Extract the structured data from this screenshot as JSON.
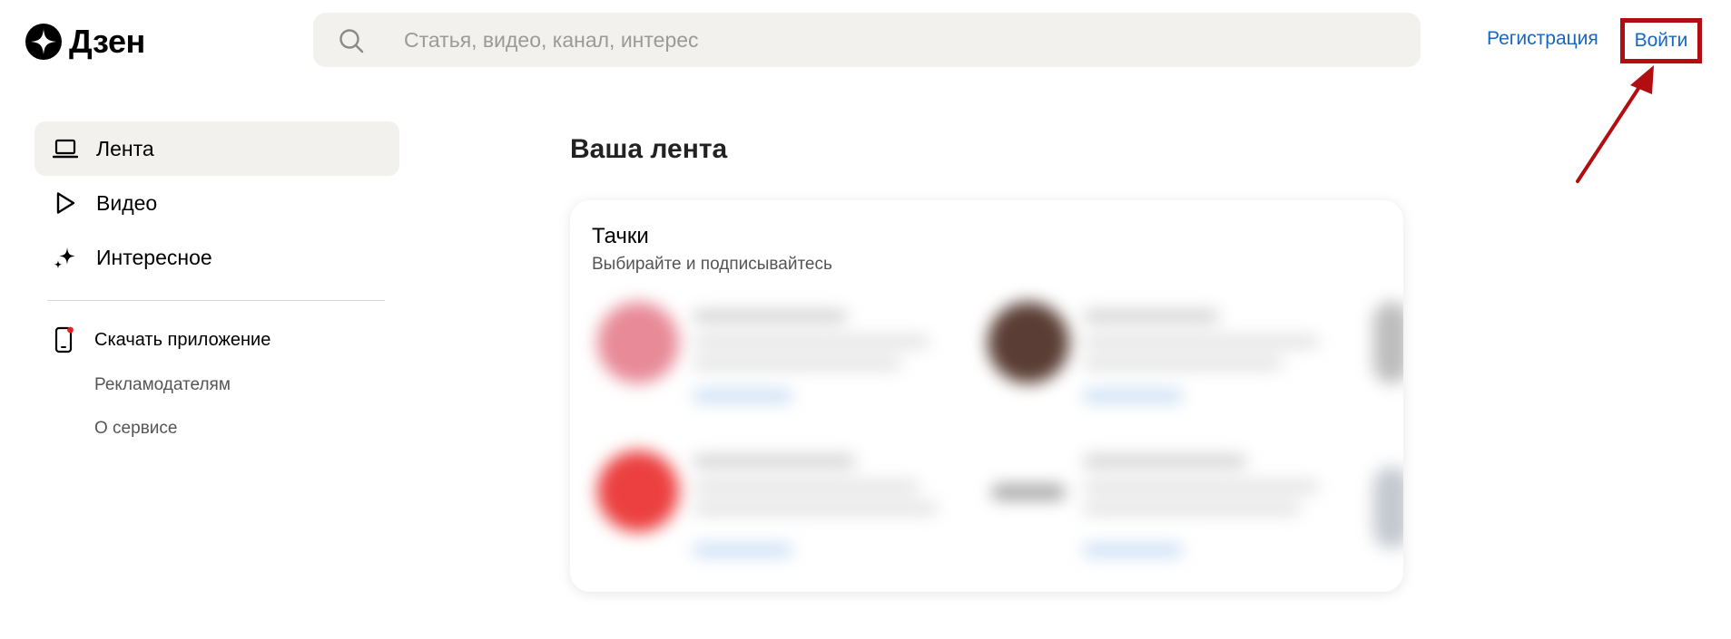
{
  "header": {
    "logo_text": "Дзен",
    "search_placeholder": "Статья, видео, канал, интерес",
    "register_label": "Регистрация",
    "login_label": "Войти"
  },
  "sidebar": {
    "items": [
      {
        "label": "Лента",
        "icon": "laptop-icon",
        "active": true
      },
      {
        "label": "Видео",
        "icon": "play-icon",
        "active": false
      },
      {
        "label": "Интересное",
        "icon": "sparkle-icon",
        "active": false
      }
    ],
    "download_label": "Скачать приложение",
    "advertisers_label": "Рекламодателям",
    "about_label": "О сервисе"
  },
  "main": {
    "title": "Ваша лента",
    "card": {
      "title": "Тачки",
      "subtitle": "Выбирайте и подписывайтесь"
    }
  },
  "colors": {
    "link": "#1766c2",
    "highlight": "#b20d10",
    "active_bg": "#f2f1ee"
  }
}
